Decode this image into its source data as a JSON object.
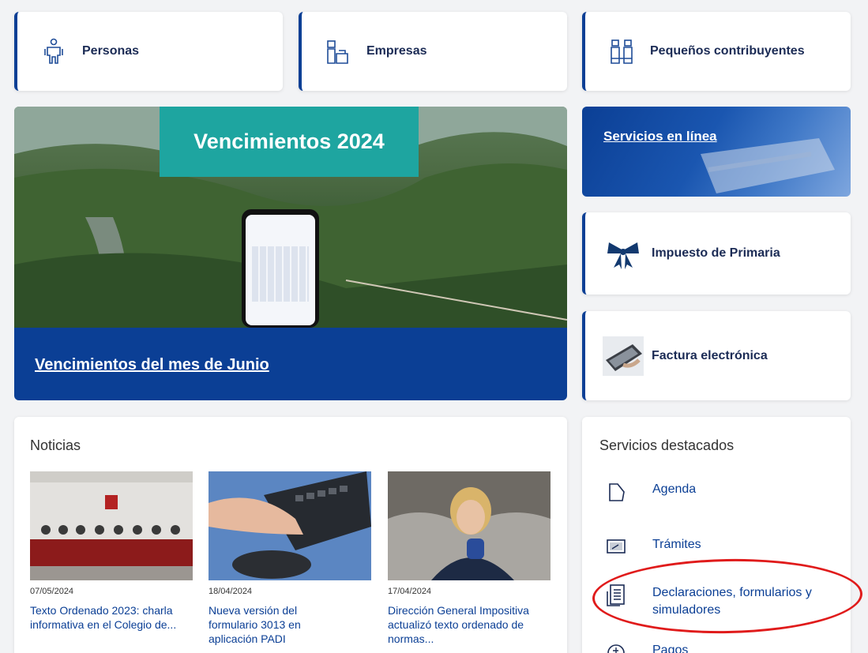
{
  "categories": [
    {
      "label": "Personas",
      "icon": "person-icon"
    },
    {
      "label": "Empresas",
      "icon": "companies-icon"
    },
    {
      "label": "Pequeños contribuyentes",
      "icon": "small-taxpayers-icon"
    }
  ],
  "hero": {
    "banner_title": "Vencimientos 2024",
    "link": "Vencimientos del mes de Junio"
  },
  "side": {
    "online_services": "Servicios en línea",
    "primaria": "Impuesto de Primaria",
    "factura": "Factura electrónica"
  },
  "news": {
    "title": "Noticias",
    "items": [
      {
        "date": "07/05/2024",
        "title": "Texto Ordenado 2023: charla informativa en el Colegio de..."
      },
      {
        "date": "18/04/2024",
        "title": "Nueva versión del formulario 3013 en aplicación PADI"
      },
      {
        "date": "17/04/2024",
        "title": "Dirección General Impositiva actualizó texto ordenado de normas..."
      }
    ]
  },
  "featured": {
    "title": "Servicios destacados",
    "items": [
      {
        "label": "Agenda",
        "icon": "agenda-icon"
      },
      {
        "label": "Trámites",
        "icon": "procedures-icon"
      },
      {
        "label": "Declaraciones, formularios y simuladores",
        "icon": "forms-icon"
      },
      {
        "label": "Pagos",
        "icon": "payments-icon"
      }
    ]
  },
  "colors": {
    "primary": "#0b3f95",
    "teal": "#1ea5a0",
    "highlight": "#e01b1b"
  }
}
